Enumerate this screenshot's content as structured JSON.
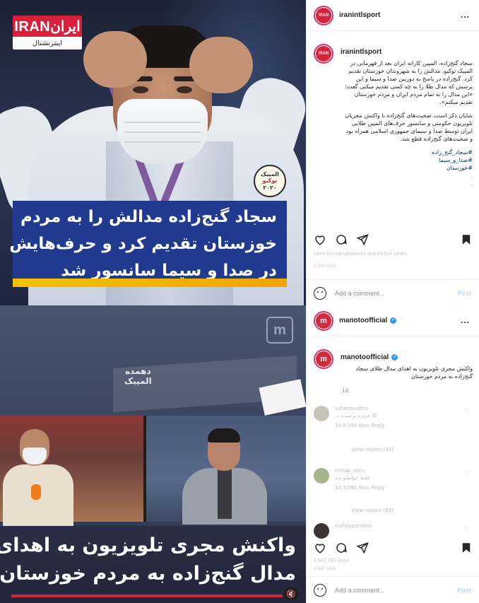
{
  "post1": {
    "image": {
      "logo_top": "IRANایران",
      "logo_bottom": "اینترنشنال",
      "badge_line1": "المپیک",
      "badge_line2": "توکیو",
      "badge_line3": "۲۰۲۰",
      "caption_lines": [
        "سجاد گنج‌زاده مدالش را به مردم",
        "خوزستان تقدیم کرد و حرف‌هایش",
        "در صدا و سیما سانسور شد"
      ]
    },
    "header": {
      "username": "iranintlsport",
      "more": "..."
    },
    "caption": {
      "username": "iranintlsport",
      "paragraph1": "سجاد گنج‌زاده، المپین کاراته ایران بعد از قهرمانی در المپیک توکیو، مدالش را به شهروندان خوزستان تقدیم کرد. گنج‌زاده در پاسخ به دوربین صدا و سیما و این پرسش که مدال طلا را به چه کسی تقدیم میکنی گفت: «این مدال را به تمام مردم ایران و مردم خوزستان تقدیم میکنم».",
      "paragraph2": "شایان ذکر است، صحبت‌های گنج‌زاده با واکنش مجریان تلویزیون حکومتی و سانسور حرف‌های المپین طلایی ایران توسط صدا و سیمای جمهوری اسلامی همراه بود و صحبت‌های گنج‌زاده قطع شد.",
      "hashtags": [
        "#سجاد_گنج_زاده",
        "#صدا_و_سیما",
        "#خوزستان"
      ],
      "dots": ".\n."
    },
    "likes_text": "Liked by reginabaheshti and 98,624 others",
    "time_text": "1 DAY AGO",
    "add_comment": {
      "placeholder": "Add a comment...",
      "post_label": "Post"
    }
  },
  "post2": {
    "image": {
      "logo_letter": "m",
      "banner_text": "دهمده\nالمپیک",
      "caption_lines": [
        "واکنش مجری تلویزیون به اهدای",
        "مدال گنج‌زاده به مردم خوزستان"
      ],
      "mute_icon": "🔇"
    },
    "header": {
      "username": "manotoofficial",
      "more": "..."
    },
    "caption": {
      "username": "manotoofficial",
      "text": "واکنش مجری تلویزیون به اهدای مدال طلای سجاد گنج‌زاده به مردم خوزستان",
      "time": "1d"
    },
    "comments": [
      {
        "user": "sahardavidnn",
        "text": "😠 عزیزم پرسیده ...",
        "meta": "1d   8,598 likes   Reply",
        "replies": "View replies (34)"
      },
      {
        "user": "mihab_ebtn",
        "text": "فقط جوابشو بده",
        "meta": "1d   3,095 likes   Reply",
        "replies": "View replies (93)"
      },
      {
        "user": "mahdyporsben",
        "text": "",
        "meta": "",
        "replies": ""
      }
    ],
    "likes_text": "1,842,783 views",
    "time_text": "1 DAY AGO",
    "add_comment": {
      "placeholder": "Add a comment...",
      "post_label": "Post"
    }
  },
  "colors": {
    "iran_red": "#d7203a",
    "caption_blue": "#1f3a8f",
    "gold": "#f2c200",
    "manoto_red": "#d12b3a",
    "link_blue": "#00376b"
  }
}
